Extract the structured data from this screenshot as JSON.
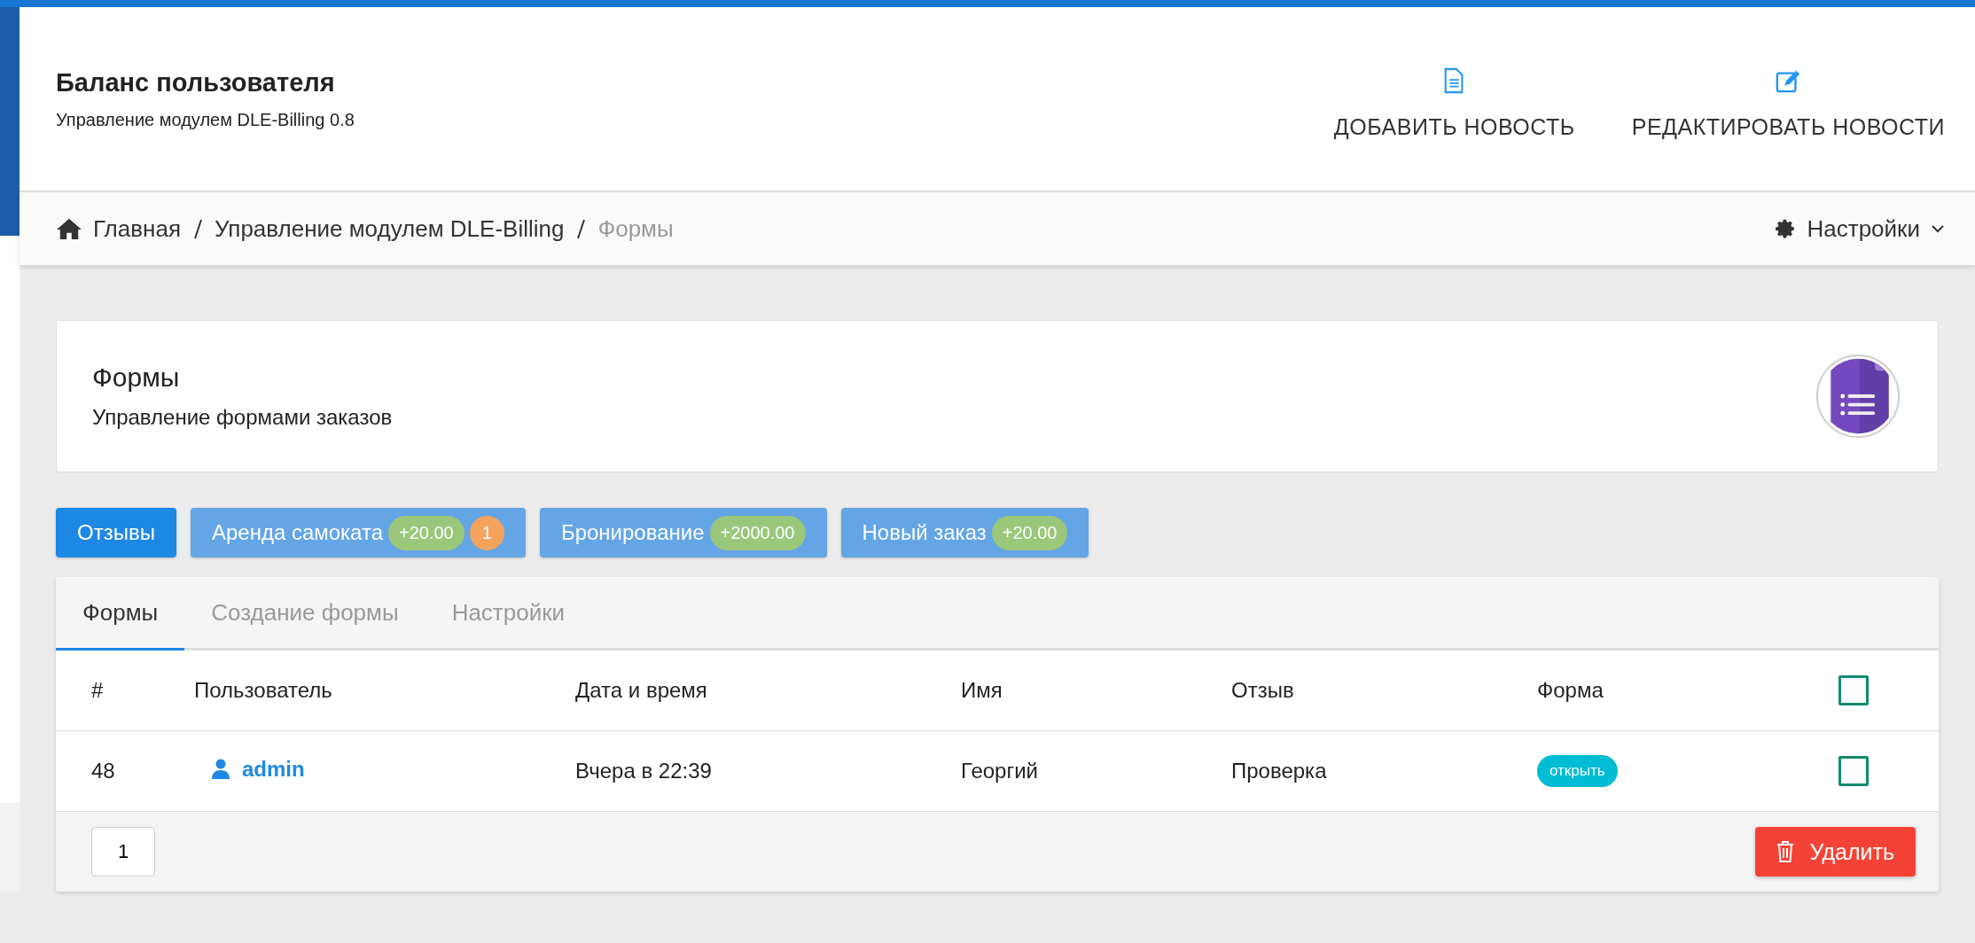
{
  "header": {
    "title": "Баланс пользователя",
    "subtitle": "Управление модулем DLE-Billing 0.8",
    "actions": [
      {
        "kind": "add",
        "label": "ДОБАВИТЬ НОВОСТЬ"
      },
      {
        "kind": "edit",
        "label": "РЕДАКТИРОВАТЬ НОВОСТИ"
      }
    ]
  },
  "breadcrumb": {
    "items": [
      {
        "label": "Главная",
        "current": false
      },
      {
        "label": "Управление модулем DLE-Billing",
        "current": false
      },
      {
        "label": "Формы",
        "current": true
      }
    ],
    "settings": "Настройки"
  },
  "card": {
    "title": "Формы",
    "subtitle": "Управление формами заказов"
  },
  "chips": [
    {
      "label": "Отзывы",
      "selected": true
    },
    {
      "label": "Аренда самоката",
      "selected": false,
      "badges": [
        {
          "kind": "amount",
          "text": "+20.00"
        },
        {
          "kind": "count",
          "text": "1"
        }
      ]
    },
    {
      "label": "Бронирование",
      "selected": false,
      "badges": [
        {
          "kind": "amount",
          "text": "+2000.00"
        }
      ]
    },
    {
      "label": "Новый заказ",
      "selected": false,
      "badges": [
        {
          "kind": "amount",
          "text": "+20.00"
        }
      ]
    }
  ],
  "tabs": [
    {
      "label": "Формы",
      "selected": true
    },
    {
      "label": "Создание формы",
      "selected": false
    },
    {
      "label": "Настройки",
      "selected": false
    }
  ],
  "table": {
    "columns": [
      "#",
      "Пользователь",
      "Дата и время",
      "Имя",
      "Отзыв",
      "Форма"
    ],
    "select_all": {
      "checked": false
    },
    "rows": [
      {
        "id": "48",
        "user": "admin",
        "date": "Вчера в 22:39",
        "name": "Георгий",
        "review": "Проверка",
        "form": "открыть",
        "checked": false
      }
    ]
  },
  "pagination": [
    {
      "label": "1"
    }
  ],
  "delete_button": "Удалить"
}
